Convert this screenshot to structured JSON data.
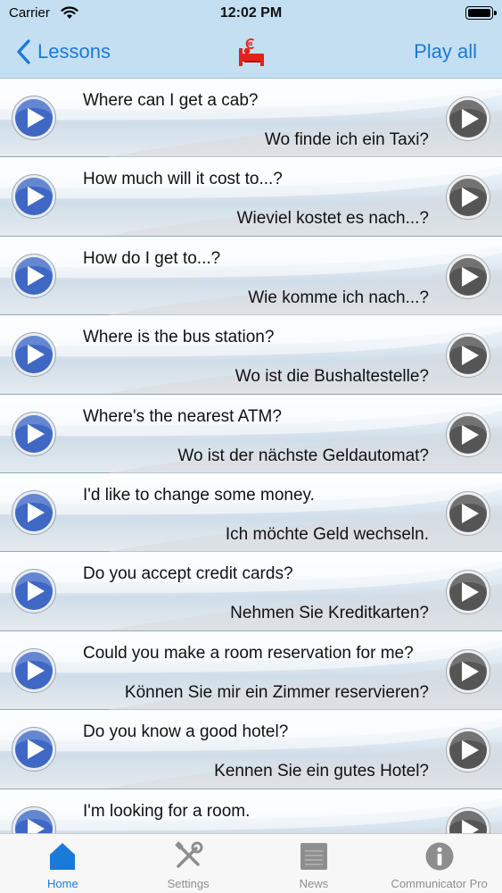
{
  "status_bar": {
    "carrier": "Carrier",
    "time": "12:02 PM"
  },
  "nav": {
    "back_label": "Lessons",
    "play_all_label": "Play all",
    "logo_icon": "euro-bed-icon"
  },
  "phrases": [
    {
      "en": "Where can I get a cab?",
      "de": "Wo finde ich ein Taxi?"
    },
    {
      "en": "How much will it cost to...?",
      "de": "Wieviel kostet es nach...?"
    },
    {
      "en": "How do I get to...?",
      "de": "Wie komme ich nach...?"
    },
    {
      "en": "Where is the bus station?",
      "de": "Wo ist die Bushaltestelle?"
    },
    {
      "en": "Where's the nearest ATM?",
      "de": "Wo ist der nächste Geldautomat?"
    },
    {
      "en": "I'd like to change some money.",
      "de": "Ich möchte Geld wechseln."
    },
    {
      "en": "Do you accept credit cards?",
      "de": "Nehmen Sie Kreditkarten?"
    },
    {
      "en": "Could you make a room reservation for me?",
      "de": "Können Sie mir ein Zimmer reservieren?"
    },
    {
      "en": "Do you know a good hotel?",
      "de": "Kennen Sie ein gutes Hotel?"
    },
    {
      "en": "I'm looking for a room.",
      "de": ""
    }
  ],
  "tabs": [
    {
      "label": "Home",
      "icon": "home-icon",
      "active": true
    },
    {
      "label": "Settings",
      "icon": "tools-icon",
      "active": false
    },
    {
      "label": "News",
      "icon": "news-icon",
      "active": false
    },
    {
      "label": "Communicator Pro",
      "icon": "info-icon",
      "active": false
    }
  ],
  "colors": {
    "accent": "#1a7ad8",
    "header_bg": "#c4dff1",
    "play_blue": "#3f67c4",
    "play_gray": "#555555"
  }
}
